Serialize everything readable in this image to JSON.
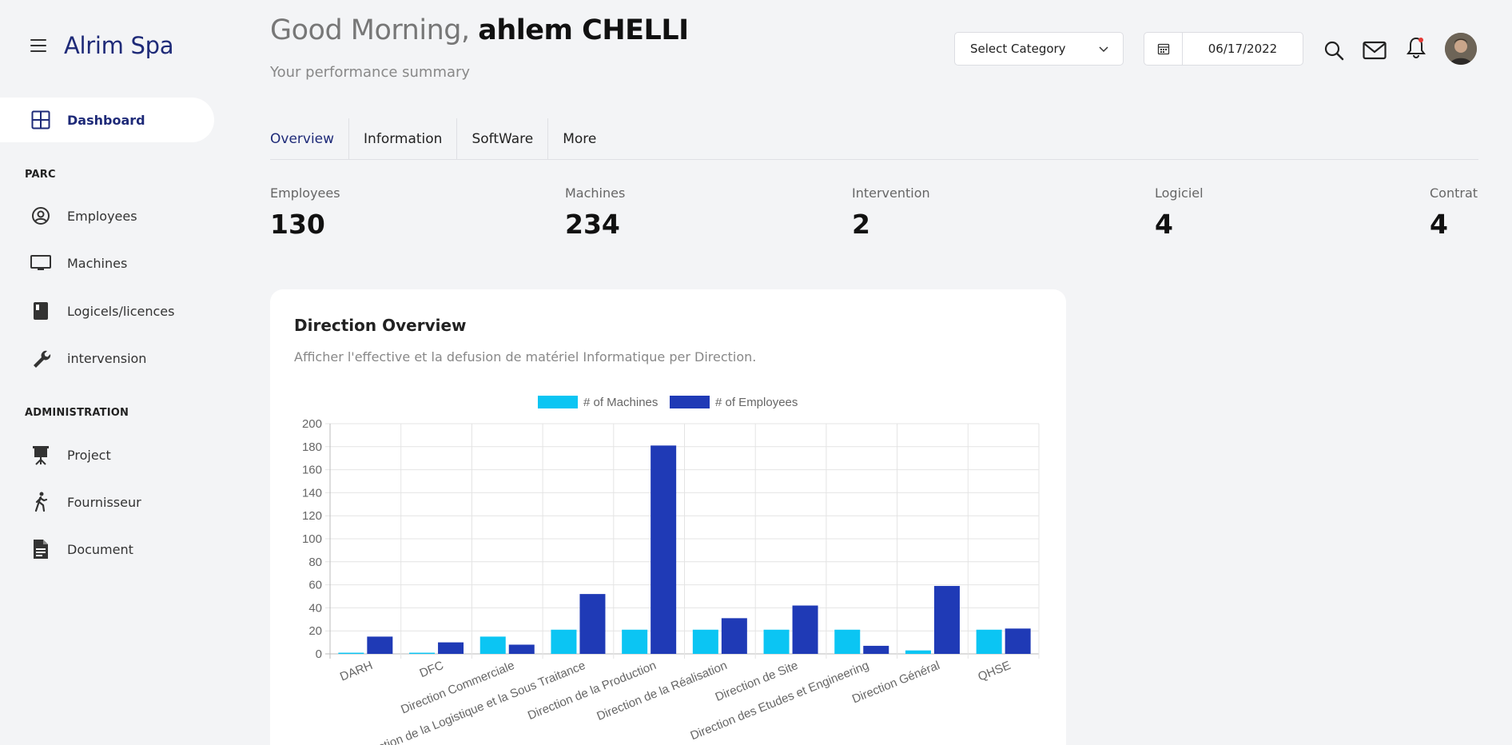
{
  "brand": {
    "name": "Alrim Spa"
  },
  "sidebar": {
    "dashboard": "Dashboard",
    "sections": [
      {
        "title": "PARC",
        "items": [
          {
            "label": "Employees",
            "icon": "user-circle-icon"
          },
          {
            "label": "Machines",
            "icon": "monitor-icon"
          },
          {
            "label": "Logicels/licences",
            "icon": "book-icon"
          },
          {
            "label": "intervension",
            "icon": "wrench-icon"
          }
        ]
      },
      {
        "title": "ADMINISTRATION",
        "items": [
          {
            "label": "Project",
            "icon": "presentation-icon"
          },
          {
            "label": "Fournisseur",
            "icon": "walking-person-icon"
          },
          {
            "label": "Document",
            "icon": "document-icon"
          }
        ]
      }
    ]
  },
  "header": {
    "greeting_prefix": "Good Morning,",
    "user_name": "ahlem CHELLI",
    "subtitle": "Your performance summary",
    "category_select": "Select Category",
    "date": "06/17/2022"
  },
  "tabs": [
    "Overview",
    "Information",
    "SoftWare",
    "More"
  ],
  "stats": [
    {
      "label": "Employees",
      "value": "130"
    },
    {
      "label": "Machines",
      "value": "234"
    },
    {
      "label": "Intervention",
      "value": "2"
    },
    {
      "label": "Logiciel",
      "value": "4"
    },
    {
      "label": "Contrat",
      "value": "4"
    }
  ],
  "card": {
    "title": "Direction Overview",
    "subtitle": "Afficher l'effective et la defusion de matériel Informatique per Direction."
  },
  "colors": {
    "accent": "#1e2a78",
    "machines": "#0bc5f3",
    "employees": "#1f3ab6"
  },
  "chart_data": {
    "type": "bar",
    "categories": [
      "DARH",
      "DFC",
      "Direction Commerciale",
      "Direction de la Logistique et la Sous Traitance",
      "Direction de la Production",
      "Direction de la Réalisation",
      "Direction de Site",
      "Direction des Etudes et Engineering",
      "Direction Général",
      "QHSE"
    ],
    "series": [
      {
        "name": "# of Machines",
        "values": [
          1,
          1,
          15,
          21,
          21,
          21,
          21,
          21,
          3,
          21
        ]
      },
      {
        "name": "# of Employees",
        "values": [
          15,
          10,
          8,
          52,
          181,
          31,
          42,
          7,
          59,
          22
        ]
      }
    ],
    "ylim": [
      0,
      200
    ],
    "yticks": [
      0,
      20,
      40,
      60,
      80,
      100,
      120,
      140,
      160,
      180,
      200
    ],
    "grid": true,
    "legend": "top"
  }
}
